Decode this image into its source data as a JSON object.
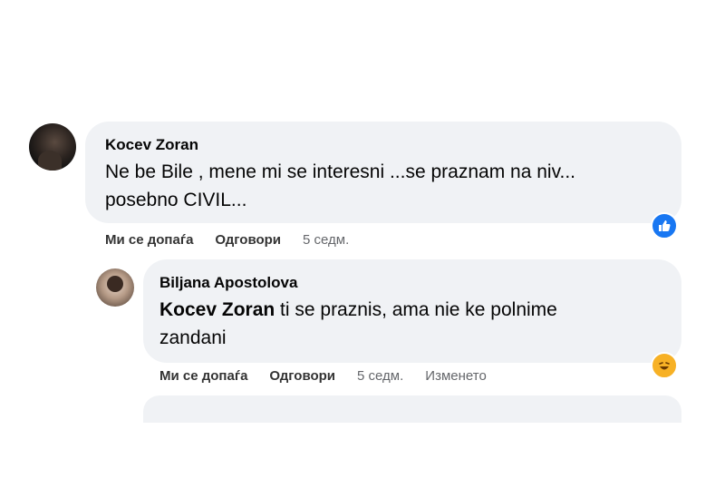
{
  "comments": [
    {
      "author": "Kocev Zoran",
      "text": "Ne be Bile , mene mi se interesni ...se praznam na niv...",
      "text_line2": "posebno CIVIL...",
      "actions": {
        "like": "Ми се допаѓа",
        "reply": "Одговори",
        "time": "5 седм."
      },
      "reaction_icon": "like-icon",
      "reaction_color": "#1877f2"
    },
    {
      "author": "Biljana Apostolova",
      "mention": "Kocev Zoran",
      "text": " ti se praznis, ama nie ke polnime",
      "text_line2": "zandani",
      "actions": {
        "like": "Ми се допаѓа",
        "reply": "Одговори",
        "time": "5 седм.",
        "edited": "Изменето"
      },
      "reaction_icon": "haha-icon",
      "reaction_color": "#f7b125"
    }
  ],
  "colors": {
    "bubble": "#f0f2f5",
    "meta": "#65676b"
  }
}
